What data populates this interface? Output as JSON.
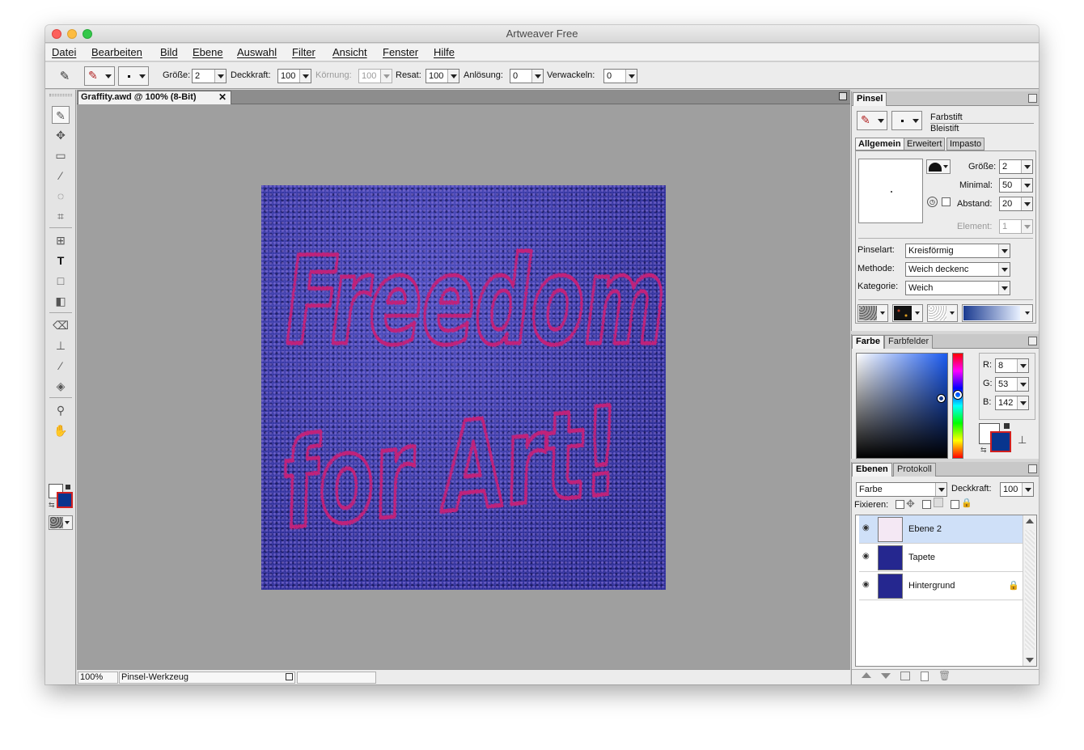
{
  "window": {
    "title": "Artweaver Free"
  },
  "menu": [
    "Datei",
    "Bearbeiten",
    "Bild",
    "Ebene",
    "Auswahl",
    "Filter",
    "Ansicht",
    "Fenster",
    "Hilfe"
  ],
  "options": {
    "groesse_label": "Größe:",
    "groesse_value": "2",
    "deckkraft_label": "Deckkraft:",
    "deckkraft_value": "100",
    "koernung_label": "Körnung:",
    "koernung_value": "100",
    "resat_label": "Resat:",
    "resat_value": "100",
    "anloesung_label": "Anlösung:",
    "anloesung_value": "0",
    "verwackeln_label": "Verwackeln:",
    "verwackeln_value": "0"
  },
  "document": {
    "tab_title": "Graffity.awd @ 100% (8-Bit)",
    "graffiti_line1": "Freedom",
    "graffiti_line2": "for Art!"
  },
  "status": {
    "zoom": "100%",
    "tool": "Pinsel-Werkzeug"
  },
  "brush_panel": {
    "tab": "Pinsel",
    "brush_category": "Farbstift",
    "brush_variant": "Bleistift",
    "subtabs": [
      "Allgemein",
      "Erweitert",
      "Impasto"
    ],
    "groesse_label": "Größe:",
    "groesse_value": "2",
    "minimal_label": "Minimal:",
    "minimal_value": "50",
    "abstand_label": "Abstand:",
    "abstand_value": "20",
    "element_label": "Element:",
    "element_value": "1",
    "pinselart_label": "Pinselart:",
    "pinselart_value": "Kreisförmig",
    "methode_label": "Methode:",
    "methode_value": "Weich deckenc",
    "kategorie_label": "Kategorie:",
    "kategorie_value": "Weich"
  },
  "color_panel": {
    "tabs": [
      "Farbe",
      "Farbfelder"
    ],
    "r_label": "R:",
    "r_value": "8",
    "g_label": "G:",
    "g_value": "53",
    "b_label": "B:",
    "b_value": "142",
    "foreground": "#ffffff",
    "background": "#08358e"
  },
  "layers_panel": {
    "tabs": [
      "Ebenen",
      "Protokoll"
    ],
    "blend_mode": "Farbe",
    "deckkraft_label": "Deckkraft:",
    "deckkraft_value": "100",
    "fixieren_label": "Fixieren:",
    "layers": [
      {
        "name": "Ebene 2",
        "selected": true
      },
      {
        "name": "Tapete",
        "selected": false
      },
      {
        "name": "Hintergrund",
        "selected": false,
        "locked": true
      }
    ]
  },
  "colors": {
    "accent_pink": "#c0207a",
    "canvas_blue": "#2b2ea0",
    "selection": "#cfe0f8"
  }
}
